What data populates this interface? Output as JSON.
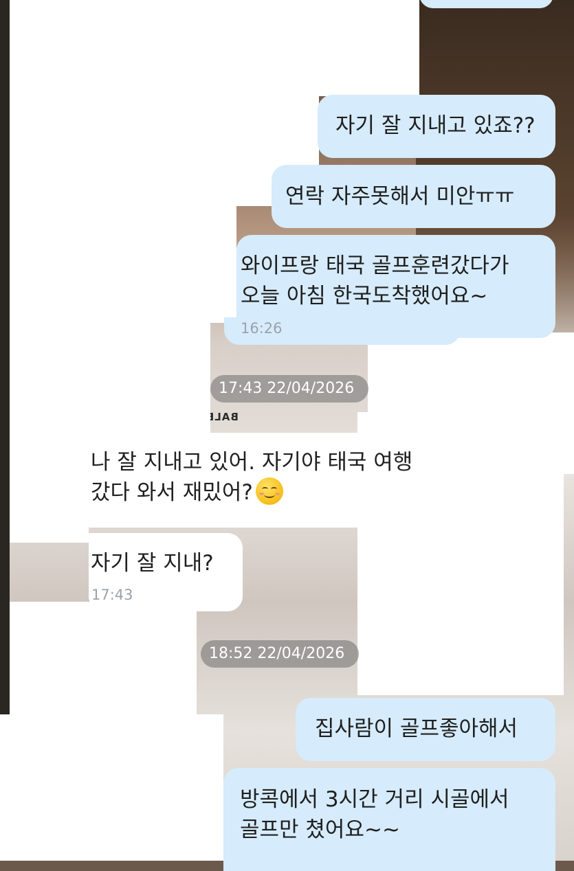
{
  "chat": {
    "outgoing_1": "자기 잘 지내고 있죠??",
    "outgoing_2": "연락 자주못해서 미안ㅠㅠ",
    "outgoing_3_line1": "와이프랑 태국 골프훈련갔다가",
    "outgoing_3_line2": "오늘 아침 한국도착했어요~",
    "outgoing_3_time": "16:26",
    "date_chip_1": "17:43 22/04/2026",
    "incoming_1_line1": "나 잘 지내고 있어. 자기야 태국 여행",
    "incoming_1_line2": "갔다 와서 재밌어?",
    "incoming_1_emoji": "smiling-face-icon",
    "incoming_2": "자기 잘 지내?",
    "incoming_2_time": "17:43",
    "date_chip_2": "18:52 22/04/2026",
    "outgoing_4": "집사람이 골프좋아해서",
    "outgoing_5_line1": "방콕에서 3시간 거리 시골에서",
    "outgoing_5_line2": "골프만 쳤어요~~"
  },
  "background": {
    "shirt_print": "BALE"
  },
  "colors": {
    "outgoing_bubble": "#d6ebfb",
    "incoming_bubble": "#ffffff",
    "timestamp": "#9aa3ab"
  }
}
